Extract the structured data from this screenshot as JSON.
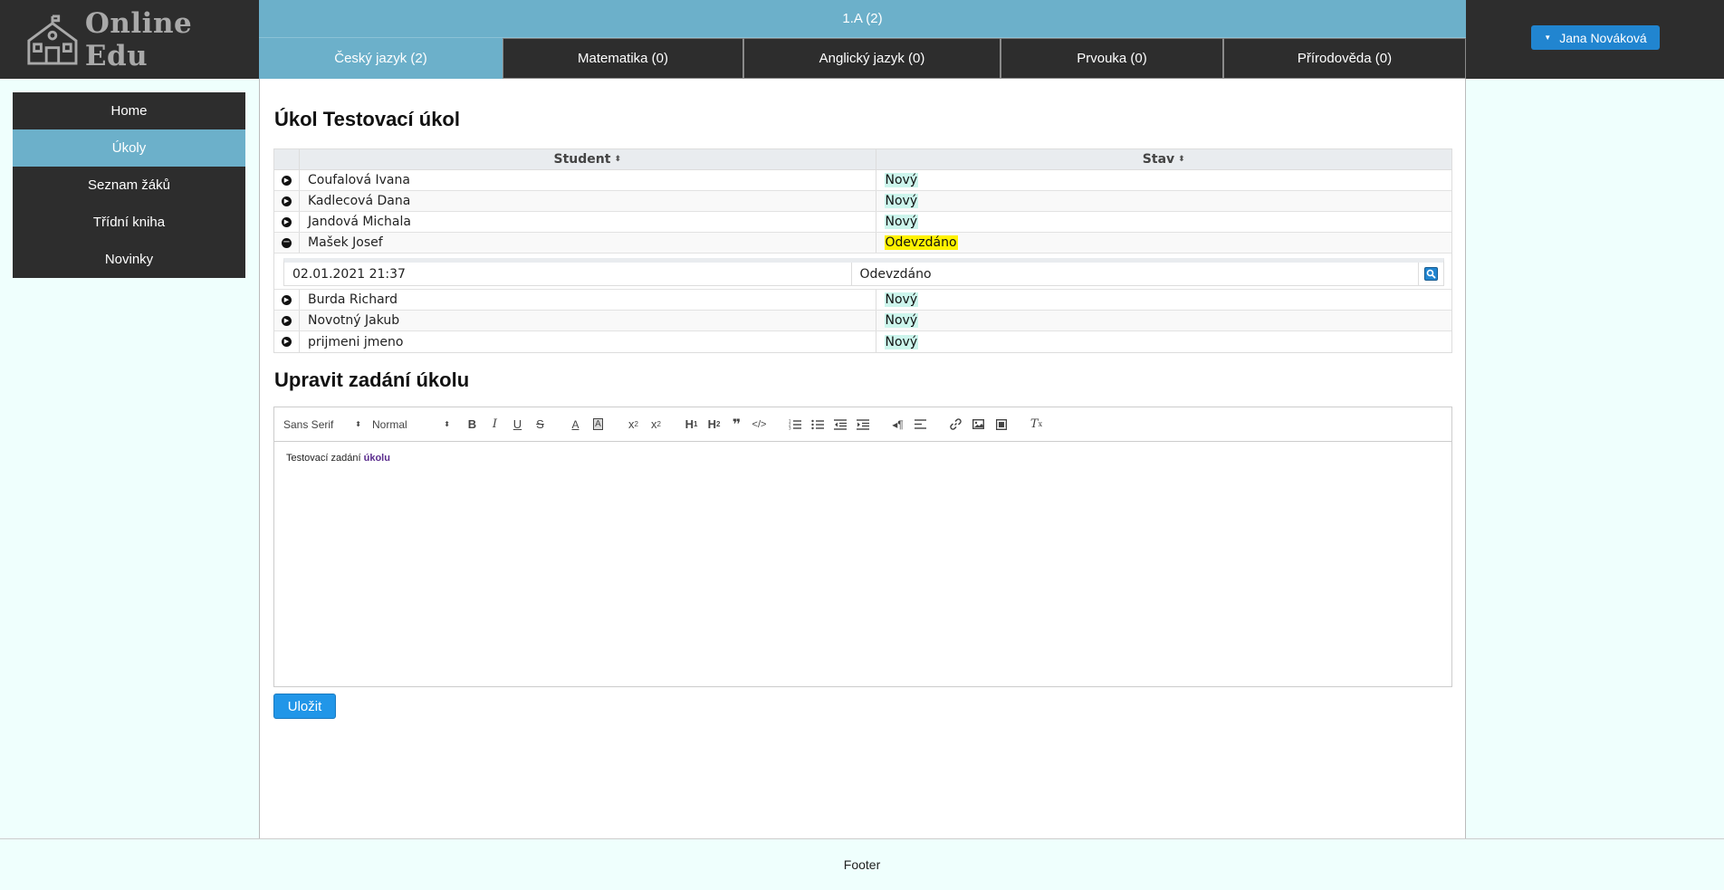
{
  "logo": {
    "text": "Online Edu"
  },
  "header": {
    "class_label": "1.A (2)",
    "tabs": [
      {
        "label": "Český jazyk (2)",
        "active": true
      },
      {
        "label": "Matematika (0)"
      },
      {
        "label": "Anglický jazyk (0)"
      },
      {
        "label": "Prvouka (0)"
      },
      {
        "label": "Přírodověda (0)"
      }
    ],
    "user_button": "Jana Nováková"
  },
  "sidebar": {
    "items": [
      {
        "label": "Home"
      },
      {
        "label": "Úkoly",
        "active": true
      },
      {
        "label": "Seznam žáků"
      },
      {
        "label": "Třídní kniha"
      },
      {
        "label": "Novinky"
      }
    ]
  },
  "main": {
    "title": "Úkol Testovací úkol",
    "grid": {
      "columns": [
        "Student",
        "Stav"
      ],
      "rows": [
        {
          "student": "Coufalová Ivana",
          "status": "Nový"
        },
        {
          "student": "Kadlecová Dana",
          "status": "Nový"
        },
        {
          "student": "Jandová Michala",
          "status": "Nový"
        },
        {
          "student": "Mašek Josef",
          "status": "Odevzdáno",
          "expanded": true
        },
        {
          "student": "Burda Richard",
          "status": "Nový"
        },
        {
          "student": "Novotný Jakub",
          "status": "Nový"
        },
        {
          "student": "prijmeni jmeno",
          "status": "Nový"
        }
      ],
      "detail": {
        "date": "02.01.2021 21:37",
        "status": "Odevzdáno"
      }
    },
    "edit_title": "Upravit zadání úkolu",
    "editor": {
      "font_select": "Sans Serif",
      "size_select": "Normal",
      "content_plain": "Testovací zadání ",
      "content_highlight": "úkolu"
    },
    "save_label": "Uložit"
  },
  "footer": {
    "text": "Footer"
  },
  "colors": {
    "header_bg": "#2d2d2d",
    "accent": "#6cb0ca",
    "button_blue": "#2185d0",
    "page_bg": "#effffd",
    "status_new_bg": "#ccf5ec",
    "status_done_bg": "#fff200"
  }
}
